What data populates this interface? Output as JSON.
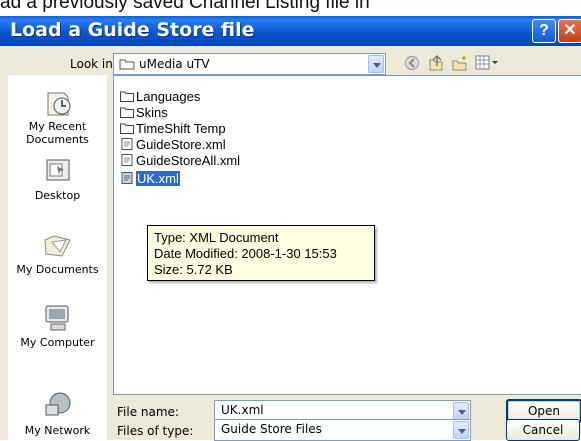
{
  "background_text": "ad a previously saved Channel Listing file in",
  "dialog": {
    "title": "Load a Guide Store file",
    "help_glyph": "?",
    "close_glyph": "✕"
  },
  "lookin": {
    "label": "Look in:",
    "value": "uMedia uTV"
  },
  "places": [
    {
      "label": "My Recent Documents",
      "icon": "recent-documents-icon"
    },
    {
      "label": "Desktop",
      "icon": "desktop-icon"
    },
    {
      "label": "My Documents",
      "icon": "my-documents-icon"
    },
    {
      "label": "My Computer",
      "icon": "my-computer-icon"
    },
    {
      "label": "My Network",
      "icon": "my-network-icon"
    }
  ],
  "files": [
    {
      "name": "Languages",
      "type": "folder"
    },
    {
      "name": "Skins",
      "type": "folder"
    },
    {
      "name": "TimeShift Temp",
      "type": "folder"
    },
    {
      "name": "GuideStore.xml",
      "type": "xml"
    },
    {
      "name": "GuideStoreAll.xml",
      "type": "xml"
    },
    {
      "name": "UK.xml",
      "type": "xml",
      "selected": true
    }
  ],
  "tooltip": {
    "type": "Type: XML Document",
    "modified": "Date Modified: 2008-1-30 15:53",
    "size": "Size: 5.72 KB"
  },
  "filename": {
    "label": "File name:",
    "value": "UK.xml"
  },
  "filetype": {
    "label": "Files of type:",
    "value": "Guide Store Files"
  },
  "buttons": {
    "open": "Open",
    "cancel": "Cancel"
  },
  "colors": {
    "titlebar": "#0b57d0",
    "dialog_bg": "#ece9d8",
    "selection": "#316ac5",
    "tooltip_bg": "#ffffe1"
  }
}
